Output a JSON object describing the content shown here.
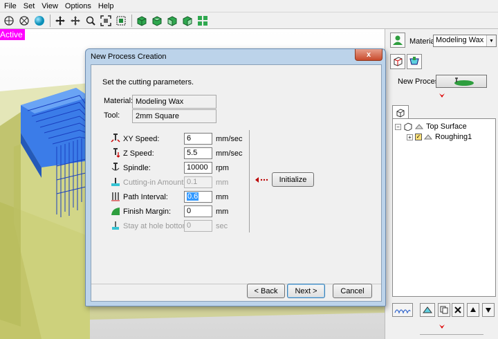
{
  "menu": [
    "File",
    "Set",
    "View",
    "Options",
    "Help"
  ],
  "viewport": {
    "mode_label": "Active"
  },
  "right_panel": {
    "material_label": "Material",
    "material_value": "Modeling Wax",
    "new_process_label": "New Process",
    "tree": [
      {
        "label": "Top Surface"
      },
      {
        "label": "Roughing1"
      }
    ]
  },
  "dialog": {
    "title": "New Process Creation",
    "close_glyph": "x",
    "instruction": "Set the cutting parameters.",
    "material_label": "Material:",
    "material_value": "Modeling Wax",
    "tool_label": "Tool:",
    "tool_value": "2mm Square",
    "params": [
      {
        "label": "XY Speed:",
        "value": "6",
        "unit": "mm/sec",
        "enabled": true
      },
      {
        "label": "Z Speed:",
        "value": "5.5",
        "unit": "mm/sec",
        "enabled": true
      },
      {
        "label": "Spindle:",
        "value": "10000",
        "unit": "rpm",
        "enabled": true
      },
      {
        "label": "Cutting-in Amount:",
        "value": "0.1",
        "unit": "mm",
        "enabled": false
      },
      {
        "label": "Path Interval:",
        "value": "0.6",
        "unit": "mm",
        "enabled": true
      },
      {
        "label": "Finish Margin:",
        "value": "0",
        "unit": "mm",
        "enabled": true
      },
      {
        "label": "Stay at hole bottom:",
        "value": "0",
        "unit": "sec",
        "enabled": false
      }
    ],
    "initialize_label": "Initialize",
    "back_label": "< Back",
    "next_label": "Next >",
    "cancel_label": "Cancel"
  },
  "colors": {
    "mode_label_bg": "#ff00ff",
    "dialog_frame": "#bcd3ea",
    "toolpath_blue": "#2c6fe0",
    "stock_yellow": "#c8cc6a"
  }
}
